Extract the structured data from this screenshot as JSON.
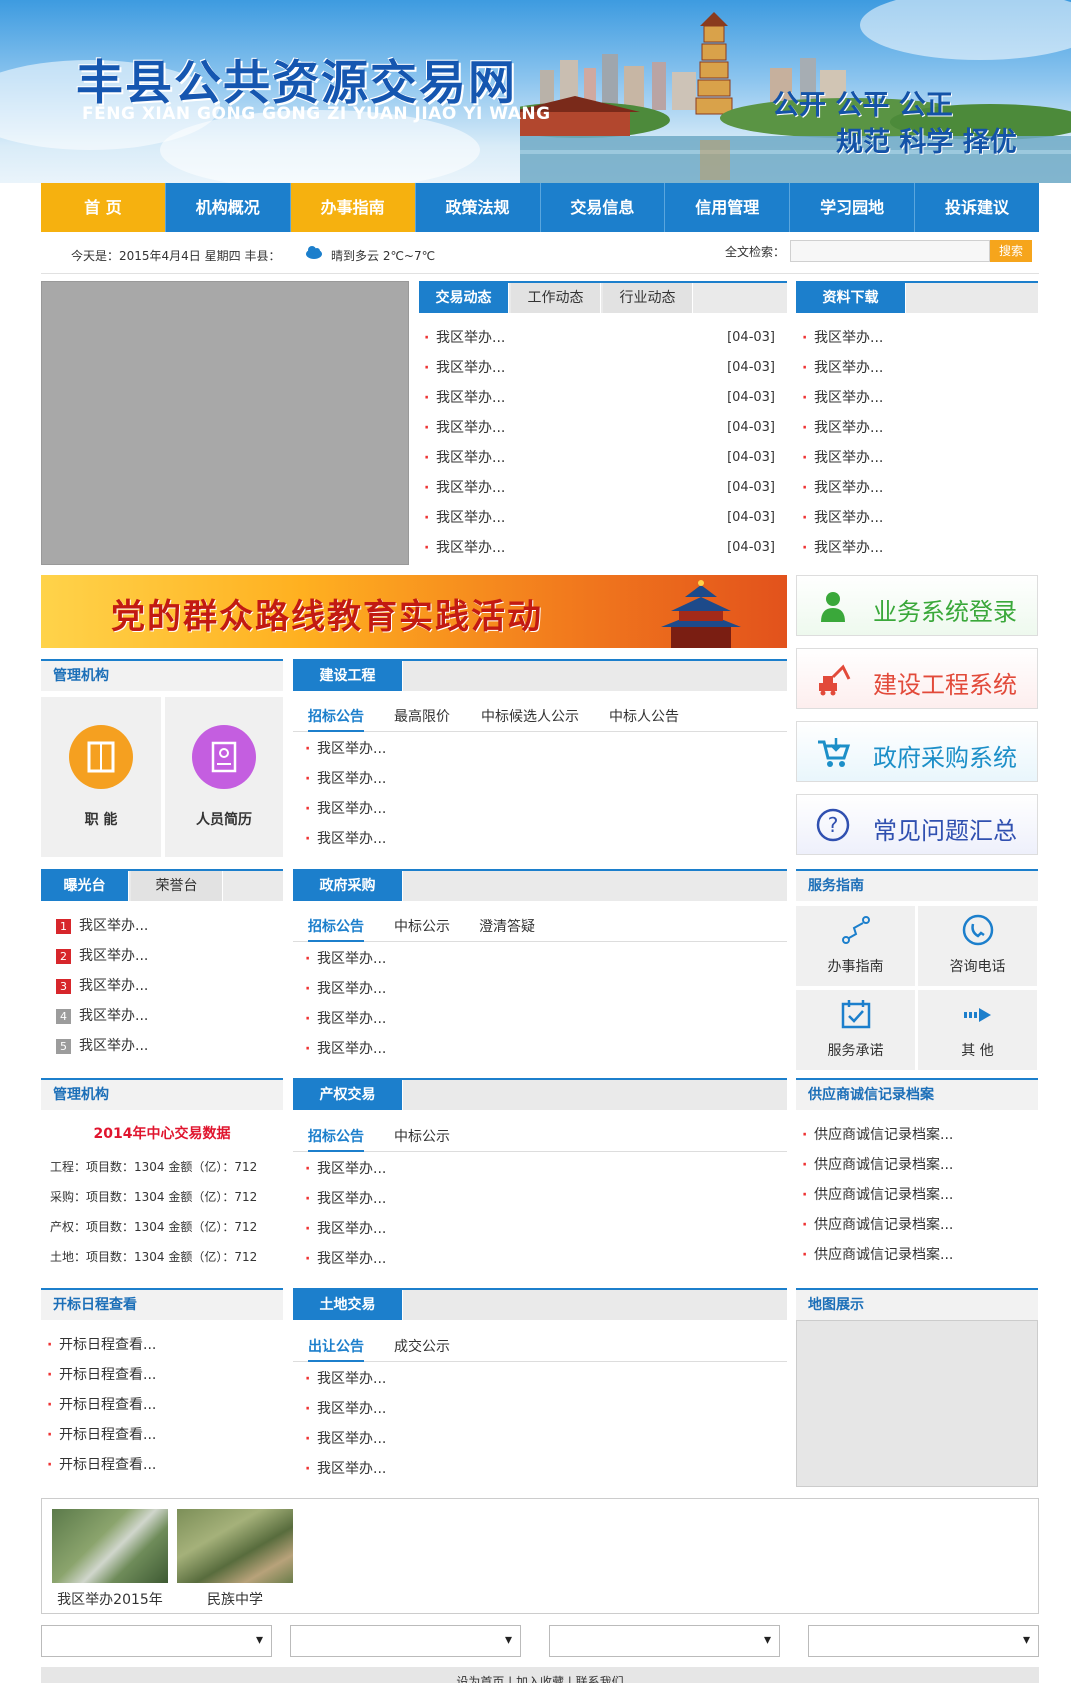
{
  "header": {
    "title": "丰县公共资源交易网",
    "pinyin": "FENG XIAN GONG GONG ZI YUAN JIAO YI WANG",
    "slogan_line1": "公开 公平 公正",
    "slogan_line2": "规范 科学 择优"
  },
  "nav": {
    "items": [
      "首  页",
      "机构概况",
      "办事指南",
      "政策法规",
      "交易信息",
      "信用管理",
      "学习园地",
      "投诉建议"
    ]
  },
  "infobar": {
    "date": "今天是：2015年4月4日  星期四    丰县：",
    "weather": "晴到多云  2℃~7℃",
    "search_label": "全文检索：",
    "search_placeholder": "",
    "search_button": "搜索"
  },
  "news": {
    "tabs": [
      "交易动态",
      "工作动态",
      "行业动态"
    ],
    "items": [
      {
        "t": "我区举办...",
        "d": "[04-03]"
      },
      {
        "t": "我区举办...",
        "d": "[04-03]"
      },
      {
        "t": "我区举办...",
        "d": "[04-03]"
      },
      {
        "t": "我区举办...",
        "d": "[04-03]"
      },
      {
        "t": "我区举办...",
        "d": "[04-03]"
      },
      {
        "t": "我区举办...",
        "d": "[04-03]"
      },
      {
        "t": "我区举办...",
        "d": "[04-03]"
      },
      {
        "t": "我区举办...",
        "d": "[04-03]"
      }
    ]
  },
  "downloads": {
    "title": "资料下载",
    "items": [
      "我区举办...",
      "我区举办...",
      "我区举办...",
      "我区举办...",
      "我区举办...",
      "我区举办...",
      "我区举办...",
      "我区举办..."
    ]
  },
  "banner": {
    "text": "党的群众路线教育实践活动"
  },
  "systems": [
    {
      "label": "业务系统登录",
      "color": "#3aa83a"
    },
    {
      "label": "建设工程系统",
      "color": "#e24a3a"
    },
    {
      "label": "政府采购系统",
      "color": "#1c8fc8"
    },
    {
      "label": "常见问题汇总",
      "color": "#3050b0"
    }
  ],
  "org": {
    "title": "管理机构",
    "items": [
      {
        "label": "职  能",
        "color": "#f5a020"
      },
      {
        "label": "人员简历",
        "color": "#c45ee0"
      }
    ]
  },
  "construction": {
    "title": "建设工程",
    "subtabs": [
      "招标公告",
      "最高限价",
      "中标候选人公示",
      "中标人公告"
    ],
    "items": [
      "我区举办...",
      "我区举办...",
      "我区举办...",
      "我区举办..."
    ]
  },
  "exposure": {
    "tabs": [
      "曝光台",
      "荣誉台"
    ],
    "items": [
      {
        "n": "1",
        "t": "我区举办...",
        "c": "#d7262b"
      },
      {
        "n": "2",
        "t": "我区举办...",
        "c": "#d7262b"
      },
      {
        "n": "3",
        "t": "我区举办...",
        "c": "#d7262b"
      },
      {
        "n": "4",
        "t": "我区举办...",
        "c": "#9c9c9c"
      },
      {
        "n": "5",
        "t": "我区举办...",
        "c": "#9c9c9c"
      }
    ]
  },
  "procurement": {
    "title": "政府采购",
    "subtabs": [
      "招标公告",
      "中标公示",
      "澄清答疑"
    ],
    "items": [
      "我区举办...",
      "我区举办...",
      "我区举办...",
      "我区举办..."
    ]
  },
  "service": {
    "title": "服务指南",
    "items": [
      "办事指南",
      "咨询电话",
      "服务承诺",
      "其  他"
    ]
  },
  "stats": {
    "title": "管理机构",
    "heading": "2014年中心交易数据",
    "rows": [
      "工程：项目数：1304 金额（亿）：712",
      "采购：项目数：1304 金额（亿）：712",
      "产权：项目数：1304 金额（亿）：712",
      "土地：项目数：1304 金额（亿）：712"
    ]
  },
  "property": {
    "title": "产权交易",
    "subtabs": [
      "招标公告",
      "中标公示"
    ],
    "items": [
      "我区举办...",
      "我区举办...",
      "我区举办...",
      "我区举办..."
    ]
  },
  "credit": {
    "title": "供应商诚信记录档案",
    "items": [
      "供应商诚信记录档案...",
      "供应商诚信记录档案...",
      "供应商诚信记录档案...",
      "供应商诚信记录档案...",
      "供应商诚信记录档案..."
    ]
  },
  "schedule": {
    "title": "开标日程查看",
    "items": [
      "开标日程查看...",
      "开标日程查看...",
      "开标日程查看...",
      "开标日程查看...",
      "开标日程查看..."
    ]
  },
  "land": {
    "title": "土地交易",
    "subtabs": [
      "出让公告",
      "成交公示"
    ],
    "items": [
      "我区举办...",
      "我区举办...",
      "我区举办...",
      "我区举办..."
    ]
  },
  "map": {
    "title": "地图展示"
  },
  "gallery": {
    "items": [
      {
        "caption": "我区举办2015年"
      },
      {
        "caption": "民族中学"
      }
    ]
  },
  "footer": {
    "links": "设为首页  |  加入收藏  |  联系我们"
  }
}
